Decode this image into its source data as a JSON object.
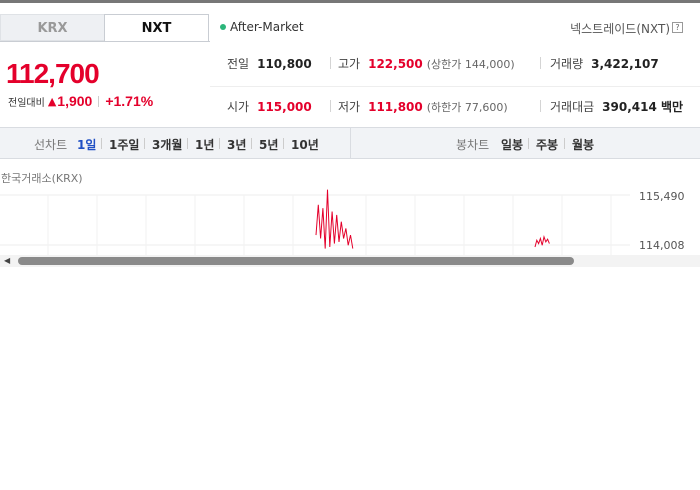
{
  "tabs": {
    "krx": "KRX",
    "nxt": "NXT"
  },
  "after_market": "After-Market",
  "nxt_name": "넥스트레이드(NXT)",
  "help": "?",
  "price": "112,700",
  "change": {
    "label": "전일대비",
    "arrow": "▲",
    "value": "1,900",
    "pct": "+1.71%"
  },
  "info": {
    "prev_label": "전일",
    "prev_value": "110,800",
    "high_label": "고가",
    "high_value": "122,500",
    "upper_limit": "(상한가 144,000)",
    "volume_label": "거래량",
    "volume_value": "3,422,107",
    "open_label": "시가",
    "open_value": "115,000",
    "low_label": "저가",
    "low_value": "111,800",
    "lower_limit": "(하한가 77,600)",
    "amount_label": "거래대금",
    "amount_value": "390,414 백만"
  },
  "period_bar": {
    "line_label": "선차트",
    "line_items": [
      "1일",
      "1주일",
      "3개월",
      "1년",
      "3년",
      "5년",
      "10년"
    ],
    "candle_label": "봉차트",
    "candle_items": [
      "일봉",
      "주봉",
      "월봉"
    ]
  },
  "chart_label": "한국거래소(KRX)",
  "chart_data": {
    "type": "line",
    "yticks": [
      "115,490",
      "114,008"
    ],
    "series_a": [
      114300,
      115200,
      114200,
      115100,
      113900,
      115650,
      113950,
      115000,
      114050,
      114900,
      114100,
      114700,
      114200,
      114500,
      114000,
      114300,
      113900
    ],
    "series_b": [
      113950,
      114150,
      114050,
      114200,
      114000,
      114250,
      114100,
      114180,
      114050
    ]
  },
  "colors": {
    "up": "#e4002b",
    "active": "#1f4fc4"
  }
}
